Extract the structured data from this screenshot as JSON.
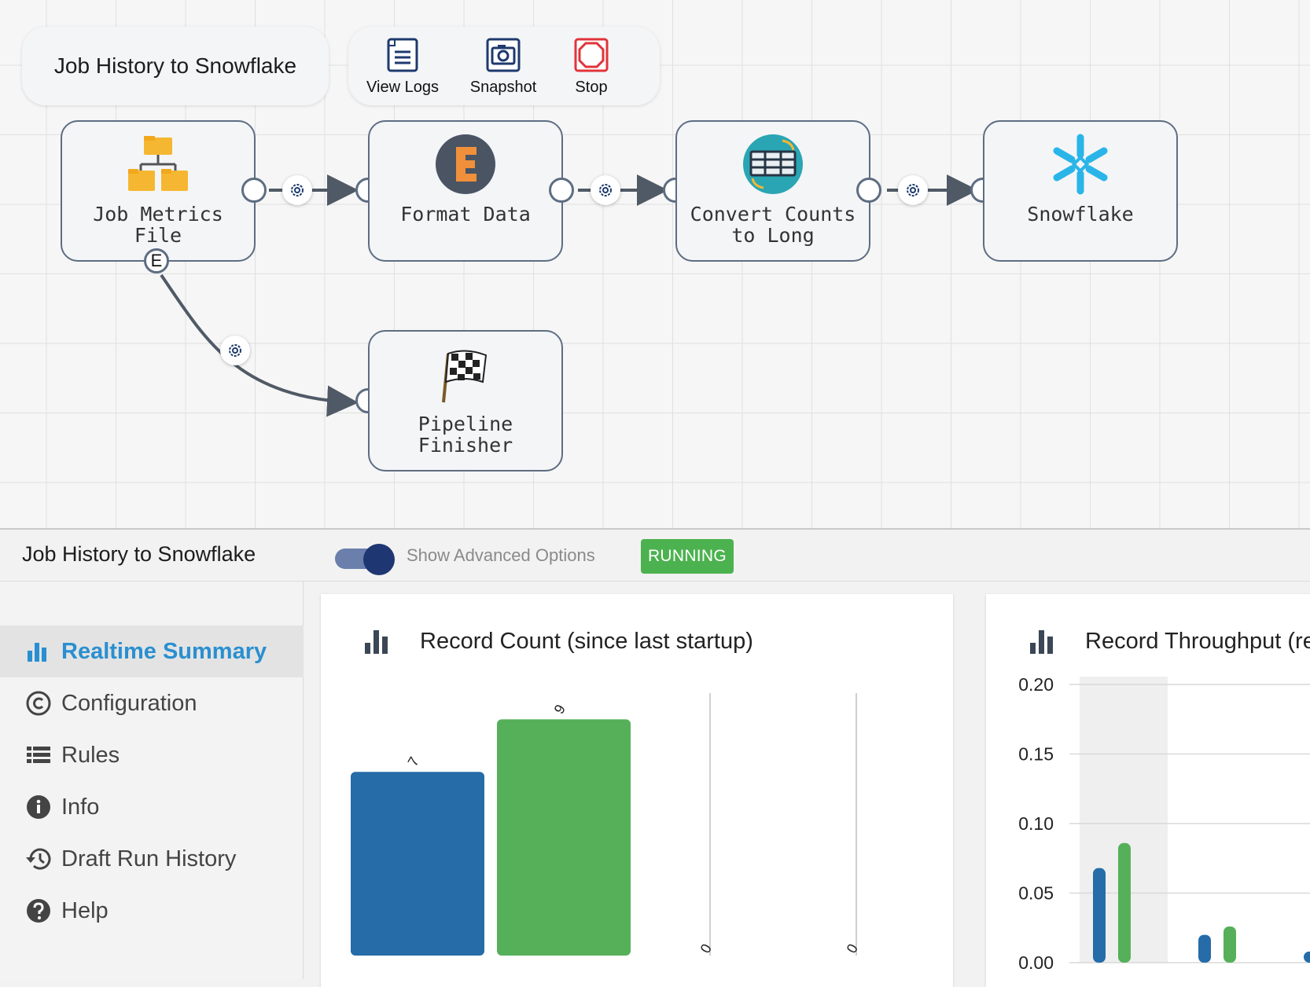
{
  "pipeline": {
    "title": "Job History to Snowflake",
    "toolbar": {
      "view_logs_label": "View Logs",
      "snapshot_label": "Snapshot",
      "stop_label": "Stop"
    }
  },
  "stages": [
    {
      "label": "Job Metrics\nFile",
      "icon": "folder-tree-icon"
    },
    {
      "label": "Format Data",
      "icon": "expression-evaluator-icon"
    },
    {
      "label": "Convert Counts\nto Long",
      "icon": "field-type-converter-icon"
    },
    {
      "label": "Snowflake",
      "icon": "snowflake-icon"
    },
    {
      "label": "Pipeline\nFinisher",
      "icon": "checkered-flag-icon"
    }
  ],
  "error_port_label": "E",
  "header": {
    "pipeline_name": "Job History to Snowflake",
    "advanced_options_label": "Show Advanced Options",
    "advanced_options_on": true,
    "status": "RUNNING"
  },
  "sidebar": {
    "items": [
      {
        "label": "Realtime Summary",
        "icon": "bar-chart-icon",
        "active": true
      },
      {
        "label": "Configuration",
        "icon": "copyright-circle-icon",
        "active": false
      },
      {
        "label": "Rules",
        "icon": "list-icon",
        "active": false
      },
      {
        "label": "Info",
        "icon": "info-icon",
        "active": false
      },
      {
        "label": "Draft Run History",
        "icon": "history-icon",
        "active": false
      },
      {
        "label": "Help",
        "icon": "question-icon",
        "active": false
      }
    ]
  },
  "colors": {
    "accent": "#2a8fd0",
    "running": "#4cb24f",
    "series_blue": "#256ca8",
    "series_green": "#56b05a"
  },
  "chart_data": [
    {
      "type": "bar",
      "title": "Record Count (since last startup)",
      "categories": [
        "",
        "",
        "",
        ""
      ],
      "values": [
        7,
        9,
        0,
        0
      ],
      "value_labels": [
        "7",
        "9",
        "0",
        "0"
      ],
      "ylim": [
        0,
        10
      ],
      "colors": [
        "#256ca8",
        "#56b05a",
        "#256ca8",
        "#56b05a"
      ]
    },
    {
      "type": "bar",
      "title": "Record Throughput (re",
      "yticks": [
        "0.20",
        "0.15",
        "0.10",
        "0.05",
        "0.00"
      ],
      "ylim": [
        0,
        0.2
      ],
      "series": [
        {
          "values": [
            0.068,
            0.02,
            0.008
          ],
          "color": "#256ca8"
        },
        {
          "values": [
            0.086,
            0.026
          ],
          "color": "#56b05a"
        }
      ]
    }
  ]
}
